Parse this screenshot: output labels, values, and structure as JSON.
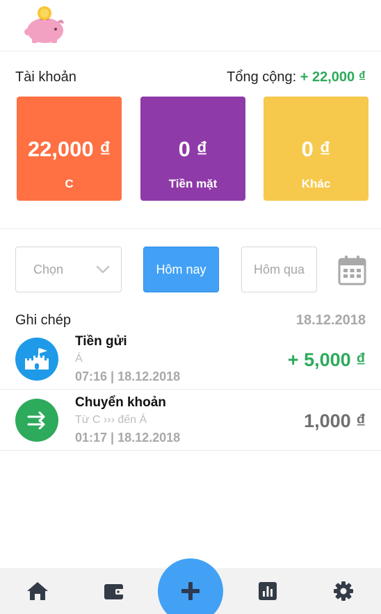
{
  "app": {
    "logo_icon": "piggy-bank-icon"
  },
  "accounts": {
    "title": "Tài khoản",
    "total_label": "Tổng cộng:",
    "total_value": "+ 22,000 ₫",
    "cards": [
      {
        "amount": "22,000 ₫",
        "name": "C",
        "color": "#ff7043"
      },
      {
        "amount": "0 ₫",
        "name": "Tiền mặt",
        "color": "#8e3aa8"
      },
      {
        "amount": "0 ₫",
        "name": "Khác",
        "color": "#f6c84c"
      }
    ]
  },
  "filters": {
    "select_placeholder": "Chọn",
    "today": "Hôm nay",
    "yesterday": "Hôm qua",
    "calendar_icon": "calendar-icon"
  },
  "records": {
    "title": "Ghi chép",
    "date": "18.12.2018",
    "items": [
      {
        "title": "Tiền gửi",
        "subtitle": "Á",
        "time": "07:16 | 18.12.2018",
        "amount": "+ 5,000 ₫",
        "amount_color": "#2eaa5c",
        "icon": "castle-icon",
        "icon_bg": "#1e9ae8"
      },
      {
        "title": "Chuyển khoản",
        "subtitle": "Từ C ››› đến Á",
        "time": "01:17 | 18.12.2018",
        "amount": "1,000 ₫",
        "amount_color": "#6f6f6f",
        "icon": "transfer-arrows-icon",
        "icon_bg": "#2eaa5c"
      }
    ]
  },
  "tabbar": {
    "items": [
      "home-icon",
      "wallet-icon",
      "add-icon",
      "chart-icon",
      "gear-icon"
    ],
    "fab_color": "#42a1f5"
  }
}
